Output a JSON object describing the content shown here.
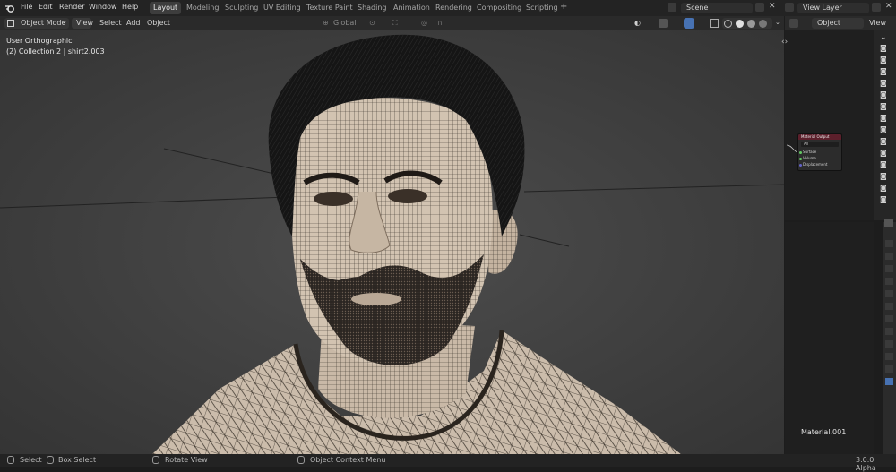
{
  "menu": [
    "File",
    "Edit",
    "Render",
    "Window",
    "Help"
  ],
  "workspaces": [
    "Layout",
    "Modeling",
    "Sculpting",
    "UV Editing",
    "Texture Paint",
    "Shading",
    "Animation",
    "Rendering",
    "Compositing",
    "Scripting"
  ],
  "active_workspace": "Layout",
  "add_workspace": "+",
  "scene_name": "Scene",
  "view_layer_name": "View Layer",
  "viewport_header": {
    "mode": "Object Mode",
    "menus": [
      "View",
      "Select",
      "Add",
      "Object"
    ],
    "transform_orientation": "Global"
  },
  "viewport": {
    "view_name": "User Orthographic",
    "collection_info": "(2) Collection 2 | shirt2.003"
  },
  "right_header": {
    "object_dropdown": "Object",
    "view_label": "View"
  },
  "node": {
    "title": "Material Output",
    "target": "All",
    "inputs": [
      "Surface",
      "Volume",
      "Displacement"
    ]
  },
  "material_name": "Material.001",
  "statusbar": {
    "select": "Select",
    "box_select": "Box Select",
    "rotate_view": "Rotate View",
    "context_menu": "Object Context Menu",
    "version": "3.0.0 Alpha"
  },
  "colors": {
    "active_tab": "#3d3d3d",
    "node_header": "#5c1f2b",
    "accent_blue": "#4772b3"
  }
}
